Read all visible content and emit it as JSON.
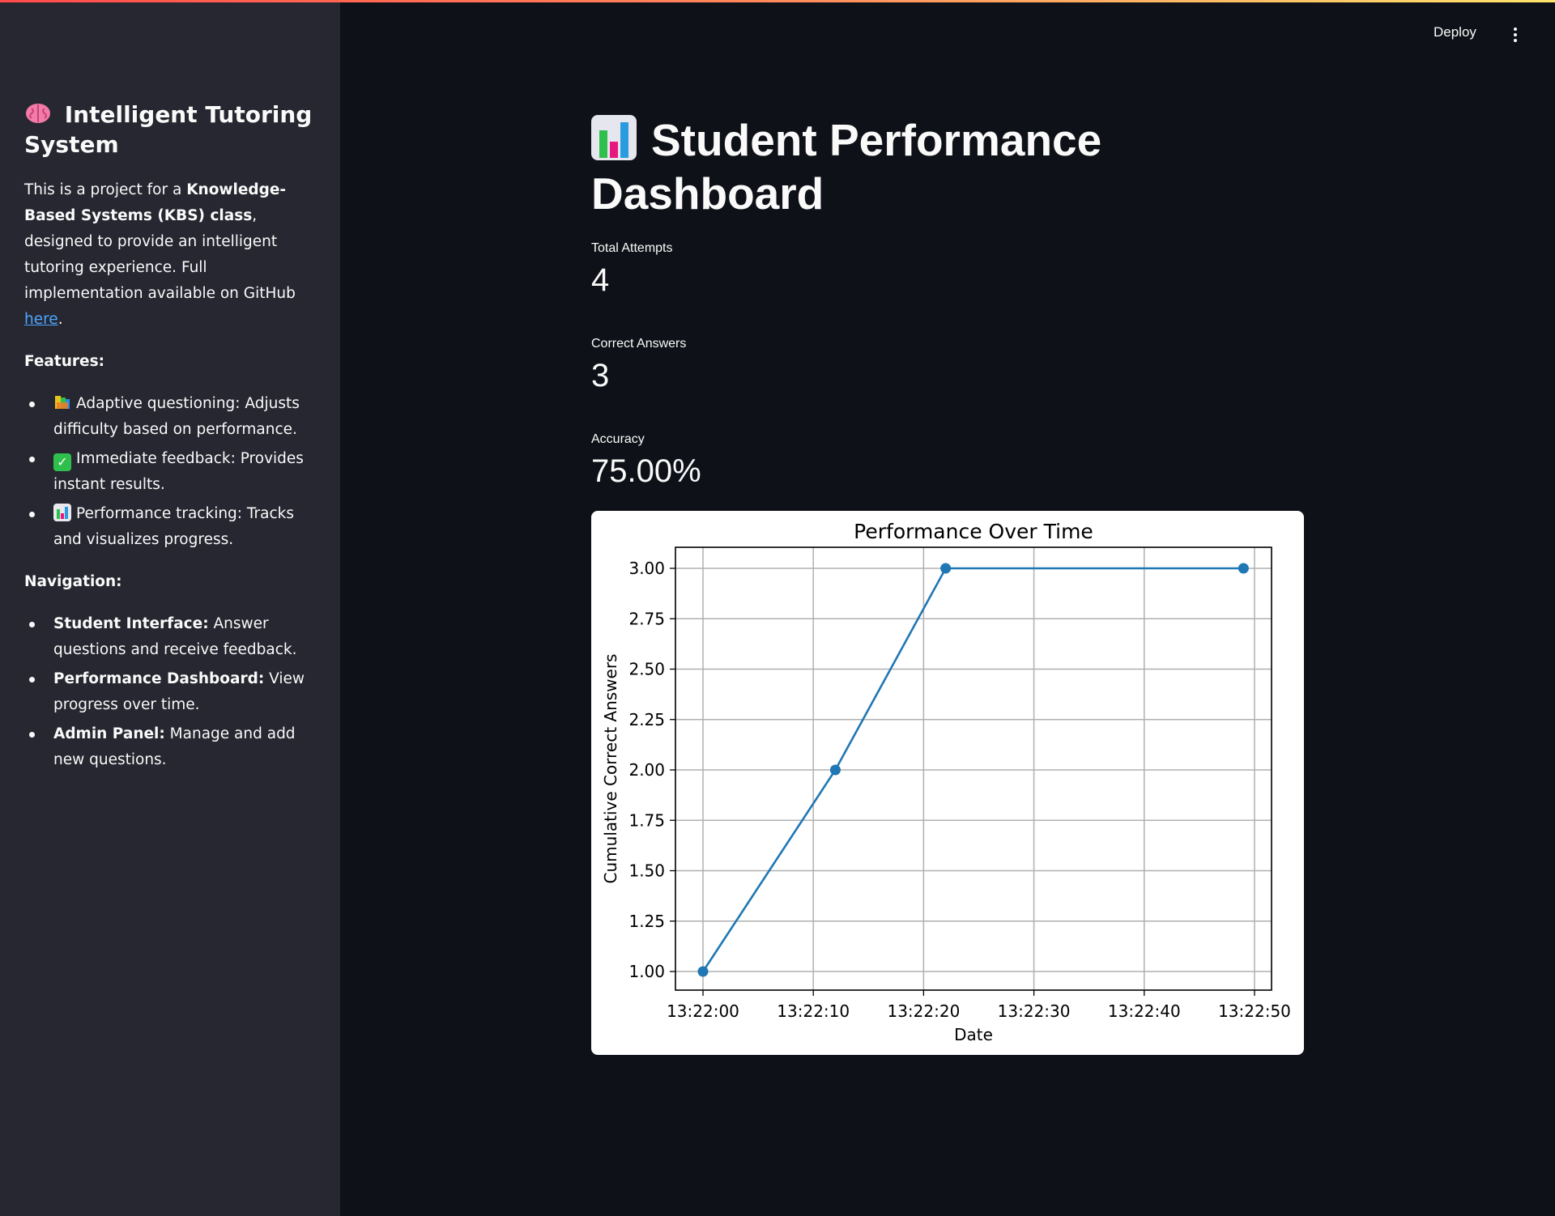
{
  "header": {
    "deploy_label": "Deploy"
  },
  "sidebar": {
    "title": "Intelligent Tutoring System",
    "intro": {
      "prefix": "This is a project for a ",
      "bold": "Knowledge-Based Systems (KBS) class",
      "middle": ", designed to provide an intelligent tutoring experience. Full implementation available on GitHub ",
      "link": "here",
      "suffix": "."
    },
    "features_heading": "Features:",
    "features": [
      {
        "icon": "books-icon",
        "text": "Adaptive questioning: Adjusts difficulty based on performance."
      },
      {
        "icon": "check-icon",
        "text": "Immediate feedback: Provides instant results."
      },
      {
        "icon": "bar-chart-icon",
        "text": "Performance tracking: Tracks and visualizes progress."
      }
    ],
    "navigation_heading": "Navigation:",
    "navigation": [
      {
        "bold": "Student Interface:",
        "text": " Answer questions and receive feedback."
      },
      {
        "bold": "Performance Dashboard:",
        "text": " View progress over time."
      },
      {
        "bold": "Admin Panel:",
        "text": " Manage and add new questions."
      }
    ]
  },
  "main": {
    "title": "Student Performance Dashboard",
    "metrics": [
      {
        "label": "Total Attempts",
        "value": "4"
      },
      {
        "label": "Correct Answers",
        "value": "3"
      },
      {
        "label": "Accuracy",
        "value": "75.00%"
      }
    ]
  },
  "colors": {
    "background": "#0e1117",
    "sidebar": "#262730",
    "line": "#1f77b4",
    "link": "#4da6ff"
  },
  "chart_data": {
    "type": "line",
    "title": "Performance Over Time",
    "xlabel": "Date",
    "ylabel": "Cumulative Correct Answers",
    "x_ticks": [
      "13:22:00",
      "13:22:10",
      "13:22:20",
      "13:22:30",
      "13:22:40",
      "13:22:50"
    ],
    "y_ticks": [
      "1.00",
      "1.25",
      "1.50",
      "1.75",
      "2.00",
      "2.25",
      "2.50",
      "2.75",
      "3.00"
    ],
    "x": [
      "13:22:00",
      "13:22:12",
      "13:22:22",
      "13:22:49"
    ],
    "y": [
      1,
      2,
      3,
      3
    ],
    "grid": true
  }
}
